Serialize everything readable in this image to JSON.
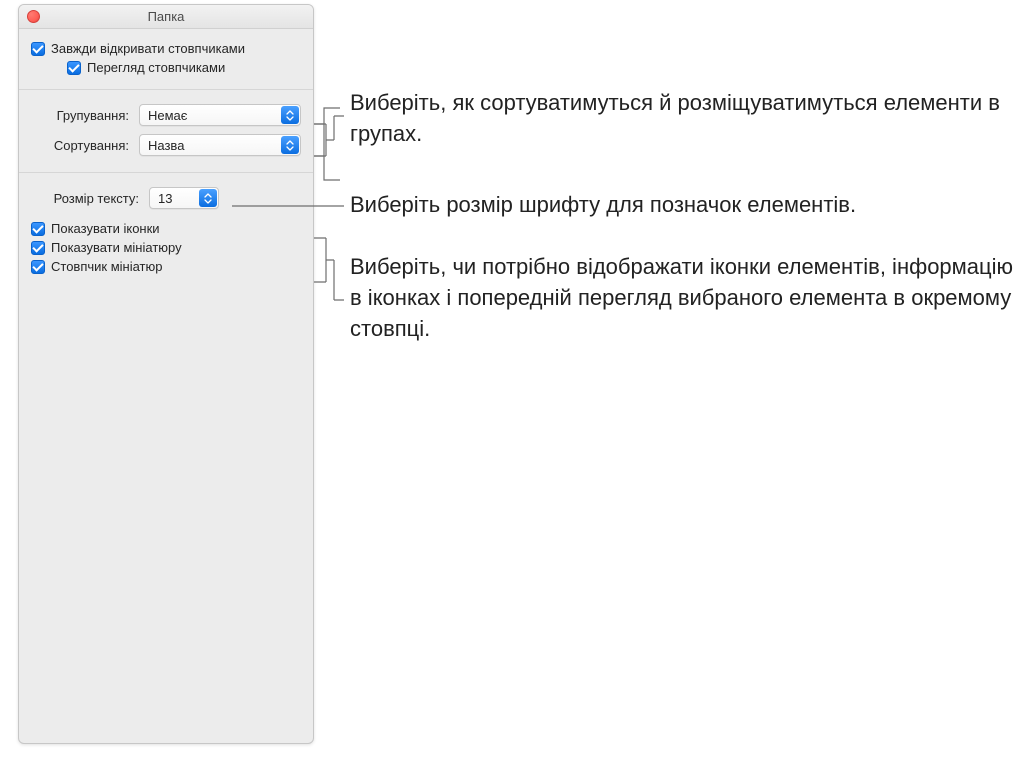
{
  "window": {
    "title": "Папка",
    "always_open_columns": "Завжди відкривати стовпчиками",
    "browse_columns": "Перегляд стовпчиками",
    "grouping_label": "Групування:",
    "grouping_value": "Немає",
    "sorting_label": "Сортування:",
    "sorting_value": "Назва",
    "text_size_label": "Розмір тексту:",
    "text_size_value": "13",
    "show_icons": "Показувати іконки",
    "show_preview": "Показувати мініатюру",
    "preview_column": "Стовпчик мініатюр"
  },
  "callouts": {
    "c1": "Виберіть, як сортуватимуться й розміщуватимуться елементи в групах.",
    "c2": "Виберіть розмір шрифту для позначок елементів.",
    "c3": "Виберіть, чи потрібно відображати іконки елементів, інформацію в іконках і попередній перегляд вибраного елемента в окремому стовпці."
  }
}
